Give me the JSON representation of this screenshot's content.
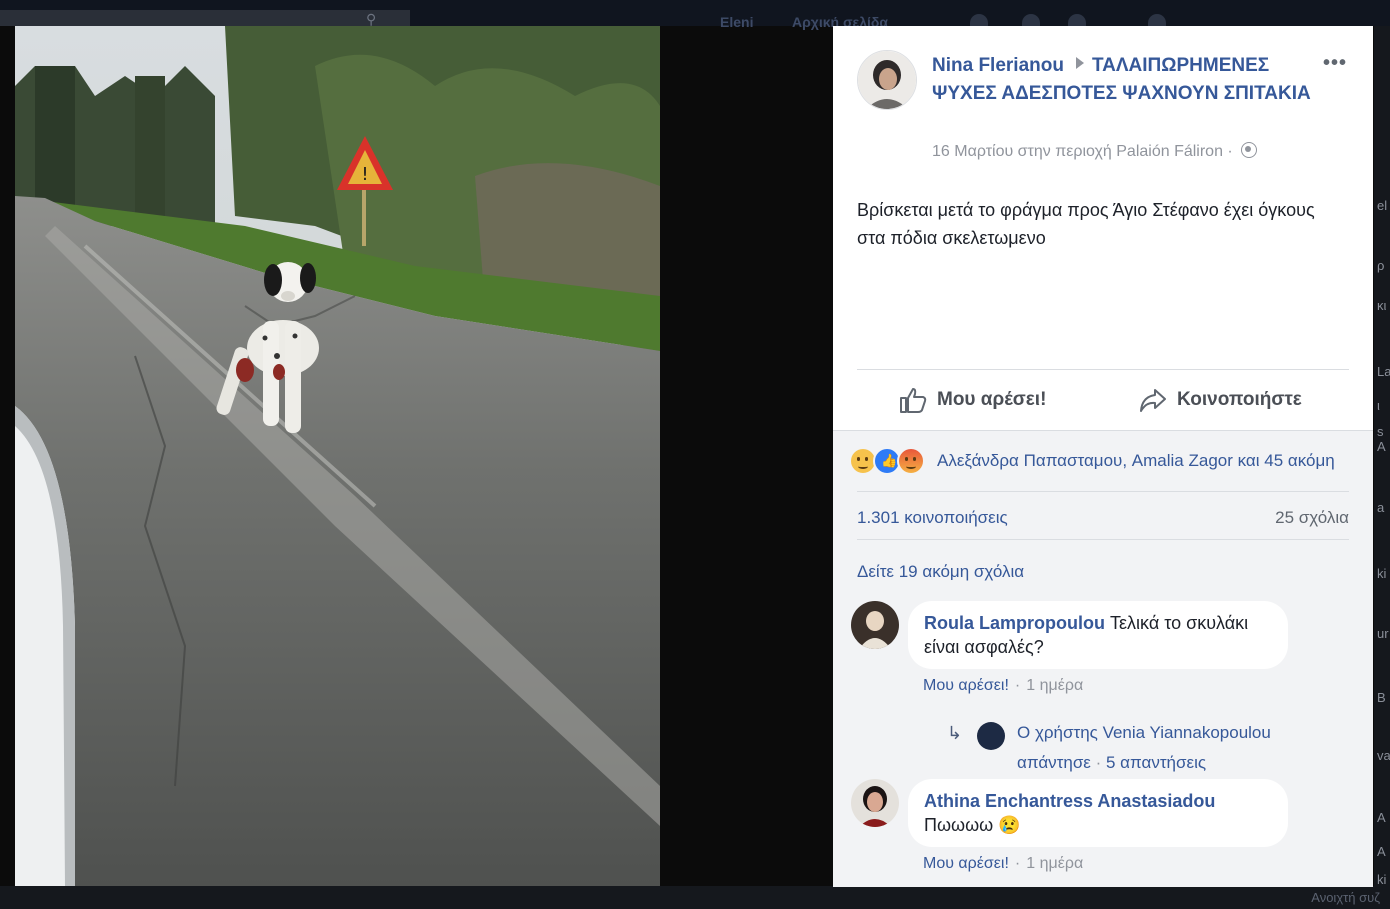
{
  "topbar": {
    "home_label": "Eleni",
    "create_label": "Αρχική σελίδα"
  },
  "post": {
    "author": "Nina Flerianou",
    "group": "ΤΑΛΑΙΠΩΡΗΜΕΝΕΣ ΨΥΧΕΣ ΑΔΕΣΠΟΤΕΣ ΨΑΧΝΟΥΝ ΣΠΙΤΑΚΙΑ",
    "meta": "16 Μαρτίου στην περιοχή Palaión Fáliron ·",
    "more": "•••",
    "text": "Βρίσκεται μετά το φράγμα προς Άγιο Στέφανο έχει όγκους στα πόδια σκελετωμενο",
    "like_label": "Μου αρέσει!",
    "share_label": "Κοινοποιήστε",
    "icons": {
      "like": "thumbs-up-icon",
      "share": "share-arrow-icon",
      "privacy": "globe-icon",
      "more": "more-options-icon"
    }
  },
  "engagement": {
    "reactions": [
      "sad-reaction",
      "like-reaction",
      "angry-reaction"
    ],
    "reactors": "Αλεξάνδρα Παπασταμου, Amalia Zagor και 45 ακόμη",
    "shares": "1.301 κοινοποιήσεις",
    "comments_count": "25 σχόλια",
    "view_more": "Δείτε 19 ακόμη σχόλια"
  },
  "comments": [
    {
      "author": "Roula Lampropoulou",
      "text": "Τελικά το σκυλάκι είναι ασφαλές?",
      "like_label": "Μου αρέσει!",
      "time": "1 ημέρα",
      "reply": {
        "text": "Ο χρήστης Venia Yiannakopoulou",
        "text2": "απάντησε",
        "count": "5 απαντήσεις"
      }
    },
    {
      "author": "Athina Enchantress Anastasiadou",
      "text": "Πωωωω 😢",
      "like_label": "Μου αρέσει!",
      "time": "1 ημέρα"
    }
  ],
  "right_edge": [
    "el",
    "ρ",
    "κι",
    "La",
    "ι",
    "s A",
    "a",
    "ki",
    "ur",
    "B",
    "va",
    "A",
    "A",
    "ki"
  ],
  "bottom": {
    "chat": "Ανοιχτή συζ"
  },
  "colors": {
    "link": "#365899",
    "muted": "#90949c",
    "panel": "#ffffff",
    "comments_bg": "#f2f3f5"
  }
}
